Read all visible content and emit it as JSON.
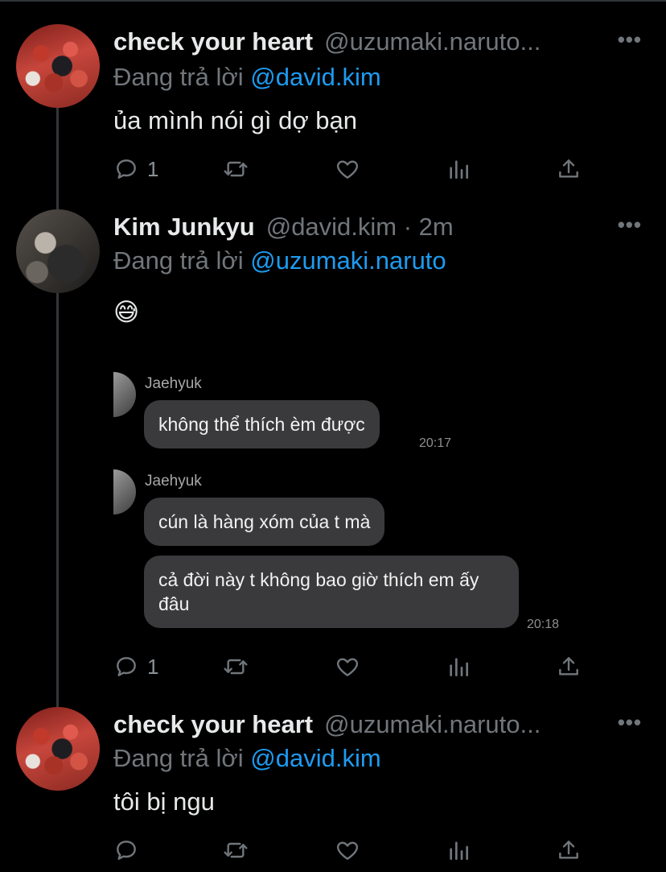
{
  "reply_prefix": "Đang trả lời",
  "tweets": [
    {
      "name": "check your heart",
      "handle": "@uzumaki.naruto...",
      "reply_to": "@david.kim",
      "text": "ủa mình nói gì dợ bạn",
      "reply_count": "1",
      "avatar": "red-hoodie-avatar"
    },
    {
      "name": "Kim Junkyu",
      "handle": "@david.kim · 2m",
      "reply_to": "@uzumaki.naruto",
      "text": "😅",
      "reply_count": "1",
      "avatar": "gray-photo-avatar"
    },
    {
      "name": "check your heart",
      "handle": "@uzumaki.naruto...",
      "reply_to": "@david.kim",
      "text": "tôi bị ngu",
      "reply_count": "",
      "avatar": "red-hoodie-avatar"
    }
  ],
  "chat": {
    "groups": [
      {
        "sender": "Jaehyuk",
        "messages": [
          "không thể thích èm được"
        ],
        "time": "20:17"
      },
      {
        "sender": "Jaehyuk",
        "messages": [
          "cún là hàng xóm của t mà",
          "cả đời này t không bao giờ thích em ấy đâu"
        ],
        "time": "20:18"
      }
    ]
  },
  "colors": {
    "background": "#000000",
    "mention": "#1d9bf0",
    "muted": "#71767b",
    "bubble": "#3a3a3c"
  },
  "icons": [
    "reply-icon",
    "retweet-icon",
    "like-icon",
    "views-icon",
    "share-icon",
    "more-icon"
  ]
}
